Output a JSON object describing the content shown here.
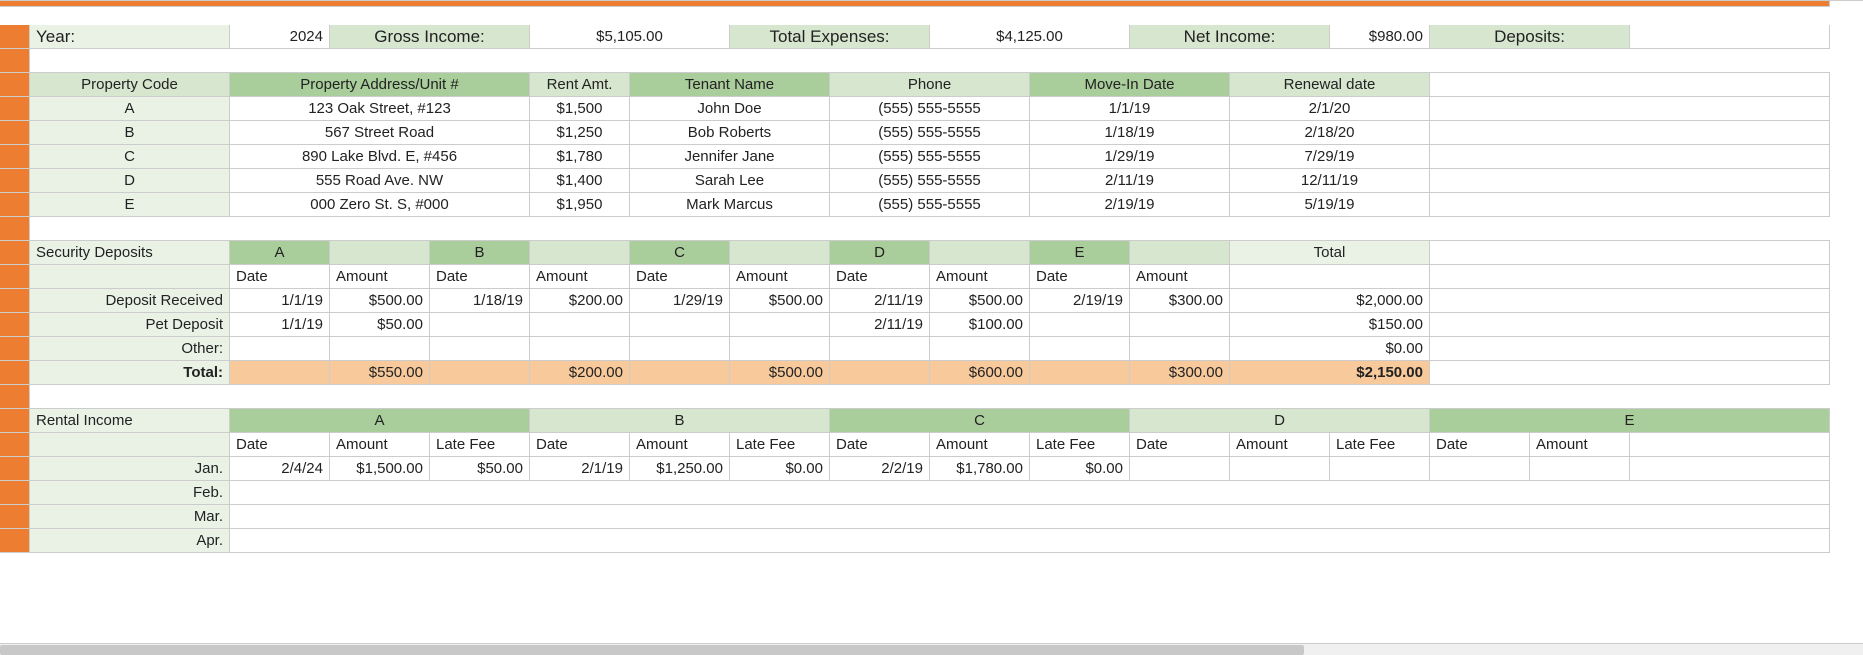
{
  "summary": {
    "year_label": "Year:",
    "year_value": "2024",
    "gross_label": "Gross Income:",
    "gross_value": "$5,105.00",
    "expenses_label": "Total Expenses:",
    "expenses_value": "$4,125.00",
    "net_label": "Net Income:",
    "net_value": "$980.00",
    "deposits_label": "Deposits:"
  },
  "property_headers": {
    "code": "Property Code",
    "address": "Property Address/Unit #",
    "rent": "Rent Amt.",
    "tenant": "Tenant Name",
    "phone": "Phone",
    "movein": "Move-In Date",
    "renewal": "Renewal date"
  },
  "properties": [
    {
      "code": "A",
      "address": "123 Oak Street, #123",
      "rent": "$1,500",
      "tenant": "John Doe",
      "phone": "(555) 555-5555",
      "movein": "1/1/19",
      "renewal": "2/1/20"
    },
    {
      "code": "B",
      "address": "567 Street Road",
      "rent": "$1,250",
      "tenant": "Bob Roberts",
      "phone": "(555) 555-5555",
      "movein": "1/18/19",
      "renewal": "2/18/20"
    },
    {
      "code": "C",
      "address": "890 Lake Blvd. E, #456",
      "rent": "$1,780",
      "tenant": "Jennifer Jane",
      "phone": "(555) 555-5555",
      "movein": "1/29/19",
      "renewal": "7/29/19"
    },
    {
      "code": "D",
      "address": "555 Road Ave. NW",
      "rent": "$1,400",
      "tenant": "Sarah Lee",
      "phone": "(555) 555-5555",
      "movein": "2/11/19",
      "renewal": "12/11/19"
    },
    {
      "code": "E",
      "address": "000 Zero St. S, #000",
      "rent": "$1,950",
      "tenant": "Mark Marcus",
      "phone": "(555) 555-5555",
      "movein": "2/19/19",
      "renewal": "5/19/19"
    }
  ],
  "deposits_section": {
    "title": "Security Deposits",
    "cols": {
      "a": "A",
      "b": "B",
      "c": "C",
      "d": "D",
      "e": "E",
      "total": "Total",
      "date": "Date",
      "amount": "Amount"
    },
    "rows": {
      "received_label": "Deposit Received",
      "pet_label": "Pet Deposit",
      "other_label": "Other:",
      "total_label": "Total:"
    },
    "received": {
      "a_date": "1/1/19",
      "a_amt": "$500.00",
      "b_date": "1/18/19",
      "b_amt": "$200.00",
      "c_date": "1/29/19",
      "c_amt": "$500.00",
      "d_date": "2/11/19",
      "d_amt": "$500.00",
      "e_date": "2/19/19",
      "e_amt": "$300.00",
      "total": "$2,000.00"
    },
    "pet": {
      "a_date": "1/1/19",
      "a_amt": "$50.00",
      "d_date": "2/11/19",
      "d_amt": "$100.00",
      "total": "$150.00"
    },
    "other": {
      "total": "$0.00"
    },
    "totals": {
      "a": "$550.00",
      "b": "$200.00",
      "c": "$500.00",
      "d": "$600.00",
      "e": "$300.00",
      "grand": "$2,150.00"
    }
  },
  "rental_section": {
    "title": "Rental Income",
    "cols": {
      "a": "A",
      "b": "B",
      "c": "C",
      "d": "D",
      "e": "E",
      "date": "Date",
      "amount": "Amount",
      "late": "Late Fee"
    },
    "months": {
      "jan": "Jan.",
      "feb": "Feb.",
      "mar": "Mar.",
      "apr": "Apr."
    },
    "jan": {
      "a_date": "2/4/24",
      "a_amt": "$1,500.00",
      "a_late": "$50.00",
      "b_date": "2/1/19",
      "b_amt": "$1,250.00",
      "b_late": "$0.00",
      "c_date": "2/2/19",
      "c_amt": "$1,780.00",
      "c_late": "$0.00"
    }
  }
}
